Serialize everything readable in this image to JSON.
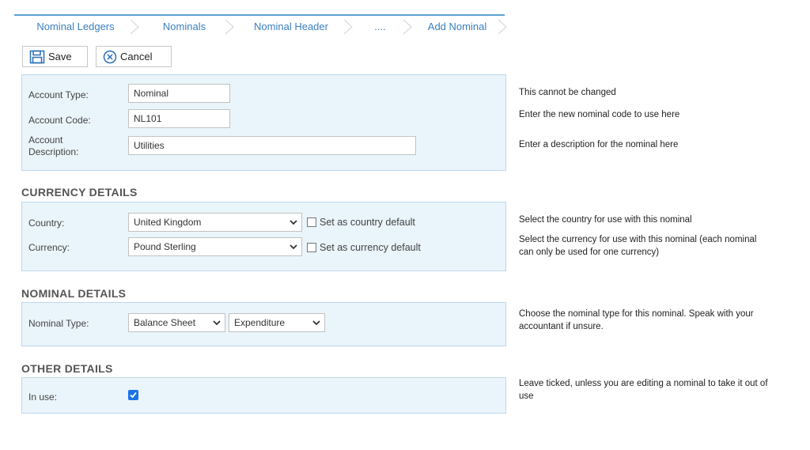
{
  "breadcrumb": {
    "items": [
      "Nominal Ledgers",
      "Nominals",
      "Nominal Header",
      "....",
      "Add Nominal"
    ]
  },
  "toolbar": {
    "save_label": "Save",
    "cancel_label": "Cancel"
  },
  "account": {
    "type_label": "Account Type:",
    "type_value": "Nominal",
    "code_label": "Account Code:",
    "code_value": "NL101",
    "description_label_line1": "Account",
    "description_label_line2": "Description:",
    "description_value": "Utilities"
  },
  "currency_details": {
    "title": "CURRENCY DETAILS",
    "country_label": "Country:",
    "country_value": "United Kingdom",
    "country_default_label": "Set as country default",
    "currency_label": "Currency:",
    "currency_value": "Pound Sterling",
    "currency_default_label": "Set as currency default"
  },
  "nominal_details": {
    "title": "NOMINAL DETAILS",
    "type_label": "Nominal Type:",
    "type_value_1": "Balance Sheet",
    "type_value_2": "Expenditure"
  },
  "other_details": {
    "title": "OTHER DETAILS",
    "in_use_label": "In use:",
    "in_use_checked": true
  },
  "notes": {
    "account_type": "This cannot be changed",
    "account_code": "Enter the new nominal code to use here",
    "account_description": "Enter a description for the nominal here",
    "country": "Select the country for use with this nominal",
    "currency": "Select the currency for use with this nominal (each nominal can only be used for one currency)",
    "nominal_type": "Choose the nominal type for this nominal. Speak with your accountant if unsure.",
    "in_use": "Leave ticked, unless you are editing a nominal to take it out of use"
  },
  "colors": {
    "accent": "#3a7fc0",
    "panel_bg": "#eaf4fb",
    "checkbox_blue": "#1a73e8"
  }
}
